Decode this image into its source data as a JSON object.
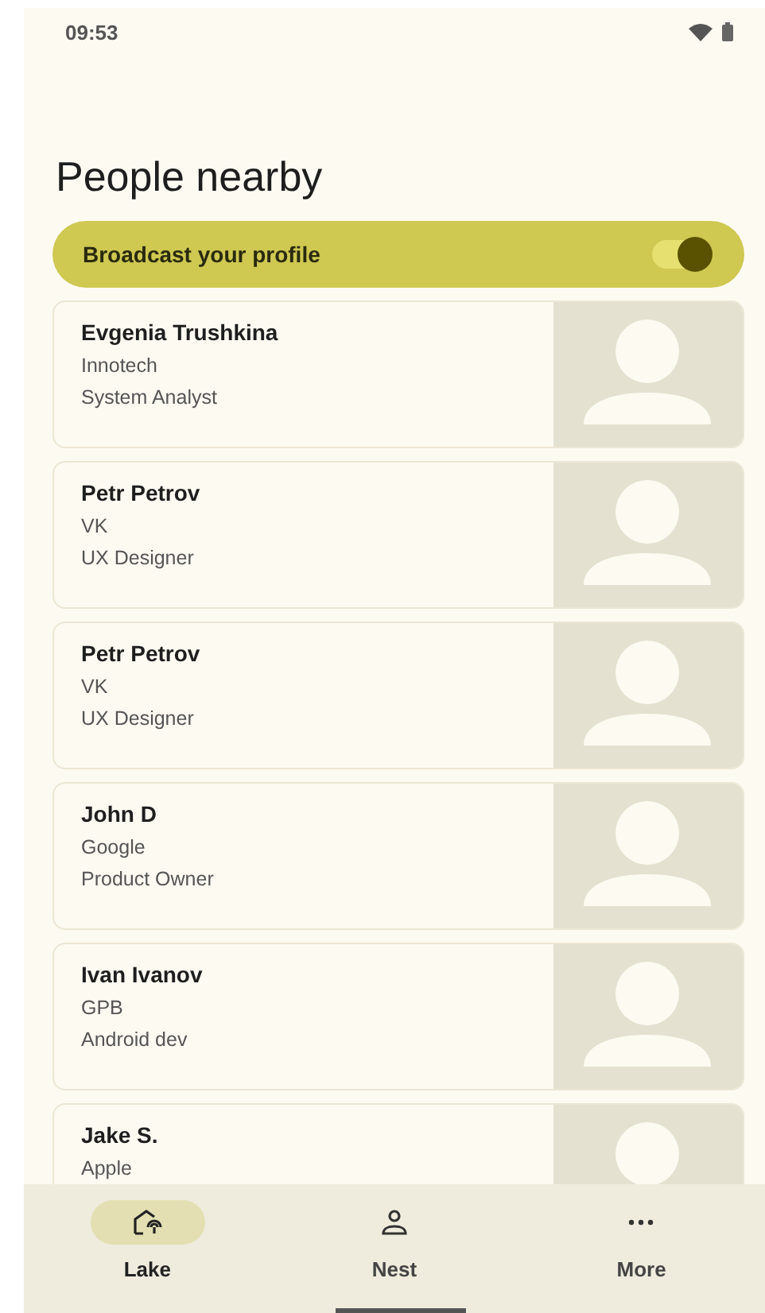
{
  "status_bar": {
    "time": "09:53"
  },
  "title": "People nearby",
  "broadcast": {
    "label": "Broadcast your profile",
    "on": true
  },
  "people": [
    {
      "name": "Evgenia Trushkina",
      "company": "Innotech",
      "role": "System Analyst"
    },
    {
      "name": "Petr Petrov",
      "company": "VK",
      "role": "UX Designer"
    },
    {
      "name": "Petr Petrov",
      "company": "VK",
      "role": "UX Designer"
    },
    {
      "name": "John D",
      "company": "Google",
      "role": "Product Owner"
    },
    {
      "name": "Ivan Ivanov",
      "company": "GPB",
      "role": "Android dev"
    },
    {
      "name": "Jake S.",
      "company": "Apple"
    }
  ],
  "nav": [
    {
      "label": "Lake",
      "kind": "lake",
      "selected": true
    },
    {
      "label": "Nest",
      "kind": "person",
      "selected": false
    },
    {
      "label": "More",
      "kind": "more",
      "selected": false
    }
  ]
}
